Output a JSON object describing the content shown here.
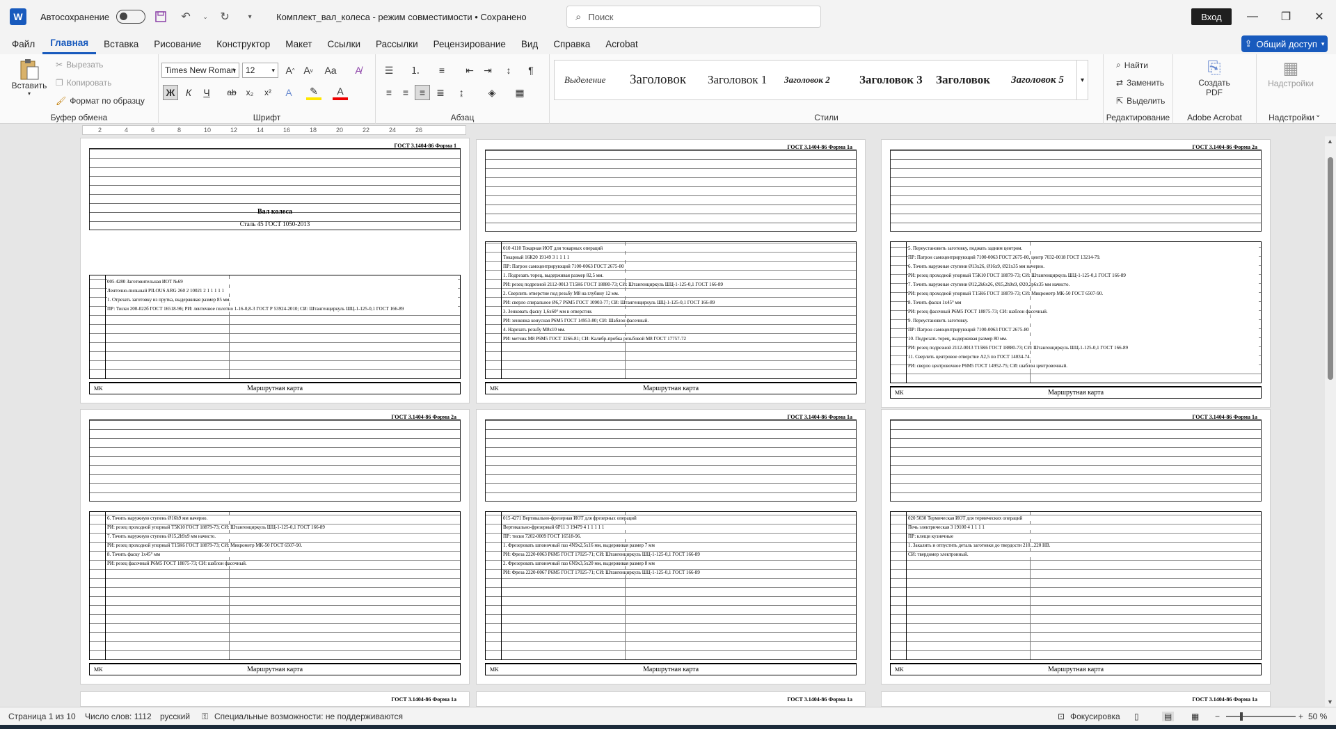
{
  "titlebar": {
    "app_icon": "W",
    "autosave_label": "Автосохранение",
    "doc_title": "Комплект_вал_колеса  -  режим совместимости • Сохранено",
    "search_placeholder": "Поиск",
    "login_label": "Вход"
  },
  "menu": {
    "tabs": [
      "Файл",
      "Главная",
      "Вставка",
      "Рисование",
      "Конструктор",
      "Макет",
      "Ссылки",
      "Рассылки",
      "Рецензирование",
      "Вид",
      "Справка",
      "Acrobat"
    ],
    "active": "Главная",
    "share_label": "Общий доступ"
  },
  "ribbon": {
    "clipboard": {
      "paste": "Вставить",
      "cut": "Вырезать",
      "copy": "Копировать",
      "format_painter": "Формат по образцу",
      "label": "Буфер обмена"
    },
    "font": {
      "name": "Times New Roman",
      "size": "12",
      "label": "Шрифт",
      "bold": "Ж",
      "italic": "К",
      "underline": "Ч",
      "strike": "ab",
      "sub": "x₂",
      "sup": "x²"
    },
    "paragraph": {
      "label": "Абзац"
    },
    "styles": {
      "items": [
        "Выделение",
        "Заголовок",
        "Заголовок 1",
        "Заголовок 2",
        "Заголовок 3",
        "Заголовок",
        "Заголовок 5"
      ],
      "label": "Стили"
    },
    "editing": {
      "find": "Найти",
      "replace": "Заменить",
      "select": "Выделить",
      "label": "Редактирование"
    },
    "acrobat": {
      "create_pdf": "Создать PDF",
      "label": "Adobe Acrobat"
    },
    "addins": {
      "button": "Надстройки",
      "label": "Надстройки"
    }
  },
  "ruler_marks": [
    "2",
    "4",
    "6",
    "8",
    "10",
    "12",
    "14",
    "16",
    "18",
    "20",
    "22",
    "24",
    "26"
  ],
  "pages": [
    {
      "gost": "ГОСТ 3.1404-86   Форма 1",
      "title": "Вал колеса",
      "steel": "Сталь 45 ГОСТ 1050-2013",
      "lines": [
        "005   4280   Заготовительная                                             ИОТ №69",
        "Ленточно-пильный PILOUS ARG 260      2    10021    2    1   1   1   1   1",
        "1. Отрезать заготовку из прутка, выдерживая размер 85 мм.",
        "ПР: Тиски 200-022б ГОСТ 16518-96; РИ: ленточное полотно 1-16-0,8-3 ГОСТ Р 53924-2010; СИ: Штангенциркуль ШЦ-1-125-0,1 ГОСТ 166-89"
      ],
      "footer": "Маршрутная карта"
    },
    {
      "gost": "ГОСТ 3.1404-86   Форма 1а",
      "lines": [
        "010   4110   Токарная                            ИОТ для токарных операций",
        "Токарный 16К20                       19149    3    1   1   1   1",
        "ПР: Патрон самоцентрирующий 7100-0063 ГОСТ 2675-80",
        "1. Подрезать торец, выдерживая размер 82,5 мм.",
        "РИ: резец подрезной 2112-0013 Т15К6 ГОСТ 18880-73; СИ: Штангенциркуль ШЦ-1-125-0,1 ГОСТ 166-89",
        "2. Сверлить отверстие под резьбу М8 на глубину 12 мм.",
        "РИ: сверло спиральное Ø6,7 Р6М5 ГОСТ 10903-77; СИ: Штангенциркуль ШЦ-1-125-0,1 ГОСТ 166-89",
        "3. Зенковать фаску 1,6х60° мм в отверстии.",
        "РИ: зенковка конусная Р6М5 ГОСТ 14953-80; СИ: Шаблон фасочный.",
        "4. Нарезать резьбу М8х10 мм.",
        "РИ: метчик М8 Р6М5 ГОСТ 3266-81; СИ: Калибр-пробка резьбовой М8 ГОСТ 17757-72"
      ],
      "footer": "Маршрутная карта"
    },
    {
      "gost": "ГОСТ 3.1404-86   Форма 2а",
      "lines": [
        "5. Переустановить заготовку, поджать задним центром.",
        "ПР: Патрон самоцентрирующий 7100-0063 ГОСТ 2675-80, центр 7032-0018 ГОСТ 13214-79.",
        "6. Точить наружные ступени Ø13х26, Ø16х9, Ø21х35 мм начерно.",
        "РИ: резец проходной упорный Т5К10 ГОСТ 18879-73; СИ: Штангенциркуль ШЦ-1-125-0,1 ГОСТ 166-89",
        "7. Точить наружные ступени Ø12,2k6х26, Ø15,2h9х9, Ø20,2р6х35 мм начисто.",
        "РИ: резец проходной упорный Т15К6 ГОСТ 18879-73; СИ: Микрометр МК-50 ГОСТ 6507-90.",
        "8. Точить фаски 1х45° мм",
        "РИ: резец фасочный Р6М5 ГОСТ 18875-73; СИ: шаблон фасочный.",
        "9. Переустановить заготовку.",
        "ПР: Патрон самоцентрирующий 7100-0063 ГОСТ 2675-80",
        "10. Подрезать торец, выдерживая размер 80 мм.",
        "РИ: резец подрезной 2112-0013 Т15К6 ГОСТ 18880-73; СИ: Штангенциркуль ШЦ-1-125-0,1 ГОСТ 166-89",
        "11. Сверлить центровое отверстие А2,5 по ГОСТ 14034-74.",
        "РИ: сверло центровочное Р6М5 ГОСТ 14952-75; СИ: шаблон центровочный."
      ],
      "footer": "Маршрутная карта"
    },
    {
      "gost": "ГОСТ 3.1404-86   Форма 2а",
      "lines": [
        "6. Точить наружную ступень Ø16h9 мм начерно.",
        "РИ: резец проходной упорный Т5К10 ГОСТ 18879-73; СИ: Штангенциркуль ШЦ-1-125-0,1 ГОСТ 166-89",
        "7. Точить наружную ступень Ø15,2h9х9 мм начисто.",
        "РИ: резец проходной упорный Т15К6 ГОСТ 18879-73; СИ: Микрометр МК-50 ГОСТ 6507-90.",
        "8. Точить фаску 1х45° мм",
        "РИ: резец фасочный Р6М5 ГОСТ 18875-73; СИ: шаблон фасочный."
      ],
      "footer": "Маршрутная карта"
    },
    {
      "gost": "ГОСТ 3.1404-86   Форма 1а",
      "lines": [
        "015   4271   Вертикально-фрезерная           ИОТ для фрезерных операций",
        "Вертикально-фрезерный 6Р11            3    19479    4   1   1   1   1   1",
        "ПР: тиски 7202-0009 ГОСТ 16518-96.",
        "1. Фрезеровать шпоночный паз 4N9х2,5х16 мм, выдерживая размер 7 мм",
        "РИ: Фреза 2220-0063 Р6М5 ГОСТ 17025-71; СИ: Штангенциркуль ШЦ-1-125-0,1 ГОСТ 166-89",
        "2. Фрезеровать шпоночный паз 6N9х3,5х20 мм, выдерживая размер 8 мм",
        "РИ: Фреза 2220-0067 Р6М5 ГОСТ 17025-71; СИ: Штангенциркуль ШЦ-1-125-0,1 ГОСТ 166-89"
      ],
      "footer": "Маршрутная карта"
    },
    {
      "gost": "ГОСТ 3.1404-86   Форма 1а",
      "lines": [
        "020   5030   Термическая                       ИОТ для термических операций",
        "Печь электрическая                    3    19100    4   1   1   1   1",
        "ПР: клещи кузнечные",
        "1. Закалить и отпустить деталь заготовки до твердости 210...220 НВ.",
        "СИ: твердомер электронный."
      ],
      "footer": "Маршрутная карта"
    }
  ],
  "bottom_pages_gost": [
    "ГОСТ 3.1404-86   Форма 1а",
    "ГОСТ 3.1404-86   Форма 1а",
    "ГОСТ 3.1404-86   Форма 1а"
  ],
  "status": {
    "page": "Страница 1 из 10",
    "words": "Число слов: 1112",
    "lang": "русский",
    "accessibility": "Специальные возможности: не поддерживаются",
    "focus": "Фокусировка",
    "zoom": "50 %"
  },
  "colors": {
    "accent": "#185abd",
    "titlebar": "#f3f3f3",
    "canvas": "#e6e6e6"
  }
}
